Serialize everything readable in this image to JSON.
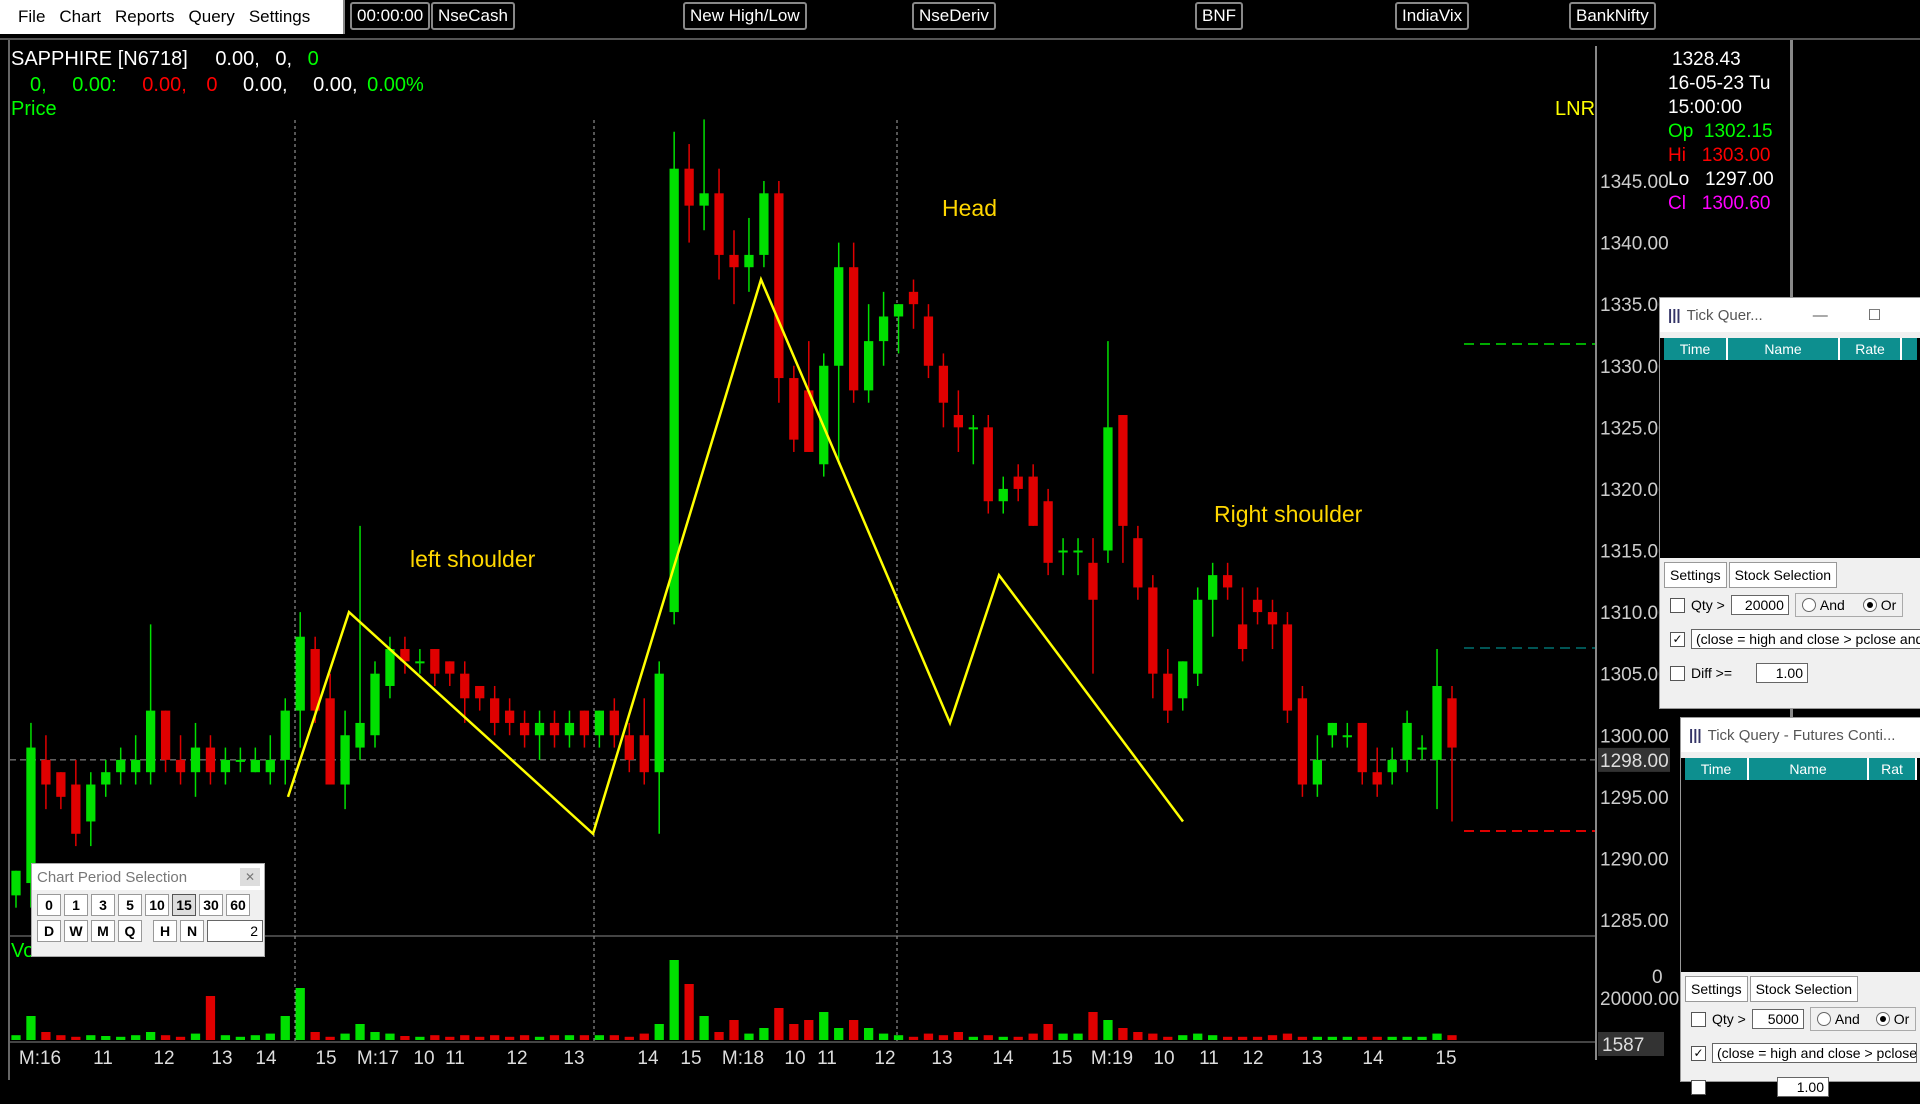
{
  "menu": [
    "File",
    "Chart",
    "Reports",
    "Query",
    "Settings"
  ],
  "toolbar": {
    "clock": "00:00:00",
    "buttons": [
      "NseCash",
      "New High/Low",
      "NseDeriv",
      "BNF",
      "IndiaVix",
      "BankNifty"
    ]
  },
  "chart": {
    "symbol": "SAPPHIRE [N6718]",
    "hdr_vals": [
      "0.00,",
      "0,",
      "0"
    ],
    "row2": [
      "0,",
      "0.00:",
      "0.00,",
      "0",
      "0.00,",
      "0.00,",
      "0.00%"
    ],
    "price_label": "Price",
    "lnr_label": "LNR",
    "vol_label": "Vo",
    "annotations": {
      "left": "left shoulder",
      "head": "Head",
      "right": "Right shoulder"
    },
    "y_ticks": [
      "1345.00",
      "1340.00",
      "1335.00",
      "1330.00",
      "1325.00",
      "1320.00",
      "1315.00",
      "1310.00",
      "1305.00",
      "1300.00",
      "1295.00",
      "1290.00",
      "1285.00"
    ],
    "current_price": "1298.00",
    "vol_tick": "20000.00",
    "vol_tick_top": "0",
    "vol_current": "1587",
    "x_labels": [
      "M:16",
      "11",
      "12",
      "13",
      "14",
      "15",
      "M:17",
      "10",
      "11",
      "12",
      "13",
      "14",
      "15",
      "M:18",
      "10",
      "11",
      "12",
      "13",
      "14",
      "15",
      "M:19",
      "10",
      "11",
      "12",
      "13",
      "14",
      "15"
    ]
  },
  "info_panel": {
    "price": "1328.43",
    "date": "16-05-23 Tu",
    "time": "15:00:00",
    "op_label": "Op",
    "op": "1302.15",
    "hi_label": "Hi",
    "hi": "1303.00",
    "lo_label": "Lo",
    "lo": "1297.00",
    "cl_label": "Cl",
    "cl": "1300.60"
  },
  "tick_query_1": {
    "title": "Tick Quer...",
    "cols": [
      "Time",
      "Name",
      "Rate"
    ],
    "tab1": "Settings",
    "tab2": "Stock Selection",
    "qty_label": "Qty >",
    "qty": "20000",
    "and": "And",
    "or": "Or",
    "condition": "(close = high and close > pclose and",
    "diff_label": "Diff >=",
    "diff": "1.00"
  },
  "tick_query_2": {
    "title": "Tick Query - Futures Conti...",
    "cols": [
      "Time",
      "Name",
      "Rat"
    ],
    "tab1": "Settings",
    "tab2": "Stock Selection",
    "qty_label": "Qty >",
    "qty": "5000",
    "and": "And",
    "or": "Or",
    "condition": "(close = high and close > pclose",
    "diff_label": "Diff >=",
    "diff": "1.00"
  },
  "period_selection": {
    "title": "Chart Period Selection",
    "row1": [
      "0",
      "1",
      "3",
      "5",
      "10",
      "15",
      "30",
      "60"
    ],
    "row2": [
      "D",
      "W",
      "M",
      "Q",
      "H",
      "N"
    ],
    "selected": "15",
    "count": "2"
  },
  "chart_data": {
    "type": "candlestick",
    "y_range": [
      1282,
      1351
    ],
    "candles": [
      {
        "o": 1287,
        "h": 1289,
        "l": 1286,
        "c": 1289,
        "v": 6
      },
      {
        "o": 1288,
        "h": 1301,
        "l": 1286,
        "c": 1299,
        "v": 30
      },
      {
        "o": 1298,
        "h": 1300,
        "l": 1294,
        "c": 1296,
        "v": 10
      },
      {
        "o": 1297,
        "h": 1297,
        "l": 1294,
        "c": 1295,
        "v": 6
      },
      {
        "o": 1296,
        "h": 1298,
        "l": 1291,
        "c": 1292,
        "v": 4
      },
      {
        "o": 1293,
        "h": 1297,
        "l": 1291,
        "c": 1296,
        "v": 6
      },
      {
        "o": 1296,
        "h": 1298,
        "l": 1295,
        "c": 1297,
        "v": 5
      },
      {
        "o": 1297,
        "h": 1299,
        "l": 1296,
        "c": 1298,
        "v": 4
      },
      {
        "o": 1297,
        "h": 1300,
        "l": 1296,
        "c": 1298,
        "v": 6
      },
      {
        "o": 1297,
        "h": 1309,
        "l": 1296,
        "c": 1302,
        "v": 10
      },
      {
        "o": 1302,
        "h": 1302,
        "l": 1297,
        "c": 1298,
        "v": 6
      },
      {
        "o": 1298,
        "h": 1300,
        "l": 1296,
        "c": 1297,
        "v": 4
      },
      {
        "o": 1297,
        "h": 1301,
        "l": 1295,
        "c": 1299,
        "v": 8
      },
      {
        "o": 1299,
        "h": 1300,
        "l": 1296,
        "c": 1297,
        "v": 55
      },
      {
        "o": 1297,
        "h": 1299,
        "l": 1296,
        "c": 1298,
        "v": 6
      },
      {
        "o": 1298,
        "h": 1299,
        "l": 1297,
        "c": 1298,
        "v": 4
      },
      {
        "o": 1297,
        "h": 1299,
        "l": 1297,
        "c": 1298,
        "v": 6
      },
      {
        "o": 1297,
        "h": 1300,
        "l": 1296,
        "c": 1298,
        "v": 8
      },
      {
        "o": 1298,
        "h": 1303,
        "l": 1296,
        "c": 1302,
        "v": 30
      },
      {
        "o": 1302,
        "h": 1310,
        "l": 1299,
        "c": 1308,
        "v": 65
      },
      {
        "o": 1307,
        "h": 1308,
        "l": 1301,
        "c": 1302,
        "v": 10
      },
      {
        "o": 1303,
        "h": 1305,
        "l": 1296,
        "c": 1296,
        "v": 4
      },
      {
        "o": 1296,
        "h": 1302,
        "l": 1294,
        "c": 1300,
        "v": 8
      },
      {
        "o": 1299,
        "h": 1317,
        "l": 1298,
        "c": 1301,
        "v": 20
      },
      {
        "o": 1300,
        "h": 1306,
        "l": 1299,
        "c": 1305,
        "v": 10
      },
      {
        "o": 1304,
        "h": 1308,
        "l": 1303,
        "c": 1307,
        "v": 8
      },
      {
        "o": 1307,
        "h": 1308,
        "l": 1305,
        "c": 1306,
        "v": 5
      },
      {
        "o": 1306,
        "h": 1307,
        "l": 1305,
        "c": 1306,
        "v": 4
      },
      {
        "o": 1307,
        "h": 1307,
        "l": 1304,
        "c": 1305,
        "v": 6
      },
      {
        "o": 1306,
        "h": 1306,
        "l": 1304,
        "c": 1305,
        "v": 4
      },
      {
        "o": 1305,
        "h": 1306,
        "l": 1301,
        "c": 1303,
        "v": 6
      },
      {
        "o": 1304,
        "h": 1304,
        "l": 1302,
        "c": 1303,
        "v": 4
      },
      {
        "o": 1303,
        "h": 1304,
        "l": 1300,
        "c": 1301,
        "v": 6
      },
      {
        "o": 1302,
        "h": 1303,
        "l": 1300,
        "c": 1301,
        "v": 4
      },
      {
        "o": 1301,
        "h": 1302,
        "l": 1299,
        "c": 1300,
        "v": 6
      },
      {
        "o": 1300,
        "h": 1302,
        "l": 1298,
        "c": 1301,
        "v": 4
      },
      {
        "o": 1301,
        "h": 1302,
        "l": 1299,
        "c": 1300,
        "v": 6
      },
      {
        "o": 1300,
        "h": 1302,
        "l": 1299,
        "c": 1301,
        "v": 6
      },
      {
        "o": 1302,
        "h": 1302,
        "l": 1299,
        "c": 1300,
        "v": 6
      },
      {
        "o": 1300,
        "h": 1302,
        "l": 1299,
        "c": 1302,
        "v": 6
      },
      {
        "o": 1302,
        "h": 1303,
        "l": 1299,
        "c": 1300,
        "v": 6
      },
      {
        "o": 1300,
        "h": 1301,
        "l": 1297,
        "c": 1298,
        "v": 4
      },
      {
        "o": 1300,
        "h": 1303,
        "l": 1296,
        "c": 1297,
        "v": 8
      },
      {
        "o": 1297,
        "h": 1306,
        "l": 1292,
        "c": 1305,
        "v": 20
      },
      {
        "o": 1310,
        "h": 1349,
        "l": 1309,
        "c": 1346,
        "v": 100
      },
      {
        "o": 1346,
        "h": 1348,
        "l": 1340,
        "c": 1343,
        "v": 70
      },
      {
        "o": 1343,
        "h": 1350,
        "l": 1341,
        "c": 1344,
        "v": 30
      },
      {
        "o": 1344,
        "h": 1346,
        "l": 1337,
        "c": 1339,
        "v": 10
      },
      {
        "o": 1339,
        "h": 1341,
        "l": 1335,
        "c": 1338,
        "v": 25
      },
      {
        "o": 1338,
        "h": 1342,
        "l": 1336,
        "c": 1339,
        "v": 8
      },
      {
        "o": 1339,
        "h": 1345,
        "l": 1338,
        "c": 1344,
        "v": 15
      },
      {
        "o": 1344,
        "h": 1345,
        "l": 1327,
        "c": 1329,
        "v": 40
      },
      {
        "o": 1329,
        "h": 1330,
        "l": 1323,
        "c": 1324,
        "v": 20
      },
      {
        "o": 1328,
        "h": 1332,
        "l": 1323,
        "c": 1323,
        "v": 25
      },
      {
        "o": 1322,
        "h": 1331,
        "l": 1321,
        "c": 1330,
        "v": 35
      },
      {
        "o": 1330,
        "h": 1340,
        "l": 1322,
        "c": 1338,
        "v": 15
      },
      {
        "o": 1338,
        "h": 1340,
        "l": 1327,
        "c": 1328,
        "v": 25
      },
      {
        "o": 1328,
        "h": 1335,
        "l": 1327,
        "c": 1332,
        "v": 15
      },
      {
        "o": 1332,
        "h": 1336,
        "l": 1330,
        "c": 1334,
        "v": 8
      },
      {
        "o": 1334,
        "h": 1335,
        "l": 1331,
        "c": 1335,
        "v": 6
      },
      {
        "o": 1336,
        "h": 1337,
        "l": 1333,
        "c": 1335,
        "v": 4
      },
      {
        "o": 1334,
        "h": 1335,
        "l": 1329,
        "c": 1330,
        "v": 8
      },
      {
        "o": 1330,
        "h": 1331,
        "l": 1325,
        "c": 1327,
        "v": 6
      },
      {
        "o": 1326,
        "h": 1328,
        "l": 1323,
        "c": 1325,
        "v": 10
      },
      {
        "o": 1325,
        "h": 1326,
        "l": 1322,
        "c": 1325,
        "v": 4
      },
      {
        "o": 1325,
        "h": 1326,
        "l": 1318,
        "c": 1319,
        "v": 6
      },
      {
        "o": 1319,
        "h": 1321,
        "l": 1318,
        "c": 1320,
        "v": 4
      },
      {
        "o": 1321,
        "h": 1322,
        "l": 1319,
        "c": 1320,
        "v": 4
      },
      {
        "o": 1321,
        "h": 1322,
        "l": 1317,
        "c": 1317,
        "v": 8
      },
      {
        "o": 1319,
        "h": 1320,
        "l": 1313,
        "c": 1314,
        "v": 20
      },
      {
        "o": 1315,
        "h": 1316,
        "l": 1313,
        "c": 1315,
        "v": 8
      },
      {
        "o": 1315,
        "h": 1316,
        "l": 1313,
        "c": 1315,
        "v": 8
      },
      {
        "o": 1314,
        "h": 1316,
        "l": 1305,
        "c": 1311,
        "v": 35
      },
      {
        "o": 1315,
        "h": 1332,
        "l": 1314,
        "c": 1325,
        "v": 25
      },
      {
        "o": 1326,
        "h": 1326,
        "l": 1314,
        "c": 1317,
        "v": 15
      },
      {
        "o": 1316,
        "h": 1317,
        "l": 1311,
        "c": 1312,
        "v": 10
      },
      {
        "o": 1312,
        "h": 1313,
        "l": 1303,
        "c": 1305,
        "v": 8
      },
      {
        "o": 1305,
        "h": 1307,
        "l": 1301,
        "c": 1302,
        "v": 4
      },
      {
        "o": 1303,
        "h": 1306,
        "l": 1302,
        "c": 1306,
        "v": 6
      },
      {
        "o": 1305,
        "h": 1312,
        "l": 1304,
        "c": 1311,
        "v": 8
      },
      {
        "o": 1311,
        "h": 1314,
        "l": 1308,
        "c": 1313,
        "v": 6
      },
      {
        "o": 1313,
        "h": 1314,
        "l": 1311,
        "c": 1312,
        "v": 4
      },
      {
        "o": 1309,
        "h": 1312,
        "l": 1306,
        "c": 1307,
        "v": 4
      },
      {
        "o": 1311,
        "h": 1312,
        "l": 1309,
        "c": 1310,
        "v": 4
      },
      {
        "o": 1310,
        "h": 1311,
        "l": 1307,
        "c": 1309,
        "v": 6
      },
      {
        "o": 1309,
        "h": 1310,
        "l": 1301,
        "c": 1302,
        "v": 8
      },
      {
        "o": 1303,
        "h": 1304,
        "l": 1295,
        "c": 1296,
        "v": 4
      },
      {
        "o": 1296,
        "h": 1300,
        "l": 1295,
        "c": 1298,
        "v": 4
      },
      {
        "o": 1300,
        "h": 1301,
        "l": 1299,
        "c": 1301,
        "v": 4
      },
      {
        "o": 1300,
        "h": 1301,
        "l": 1299,
        "c": 1300,
        "v": 4
      },
      {
        "o": 1301,
        "h": 1301,
        "l": 1296,
        "c": 1297,
        "v": 4
      },
      {
        "o": 1297,
        "h": 1299,
        "l": 1295,
        "c": 1296,
        "v": 4
      },
      {
        "o": 1297,
        "h": 1299,
        "l": 1296,
        "c": 1298,
        "v": 4
      },
      {
        "o": 1298,
        "h": 1302,
        "l": 1297,
        "c": 1301,
        "v": 4
      },
      {
        "o": 1299,
        "h": 1300,
        "l": 1298,
        "c": 1299,
        "v": 4
      },
      {
        "o": 1298,
        "h": 1307,
        "l": 1294,
        "c": 1304,
        "v": 8
      },
      {
        "o": 1303,
        "h": 1304,
        "l": 1293,
        "c": 1299,
        "v": 6
      }
    ],
    "zigzag": [
      [
        280,
        1295
      ],
      [
        341,
        1310
      ],
      [
        585,
        1292
      ],
      [
        753,
        1337
      ],
      [
        942,
        1301
      ],
      [
        991,
        1313
      ],
      [
        1175,
        1293
      ]
    ],
    "session_breaks": [
      287,
      586,
      889
    ]
  }
}
